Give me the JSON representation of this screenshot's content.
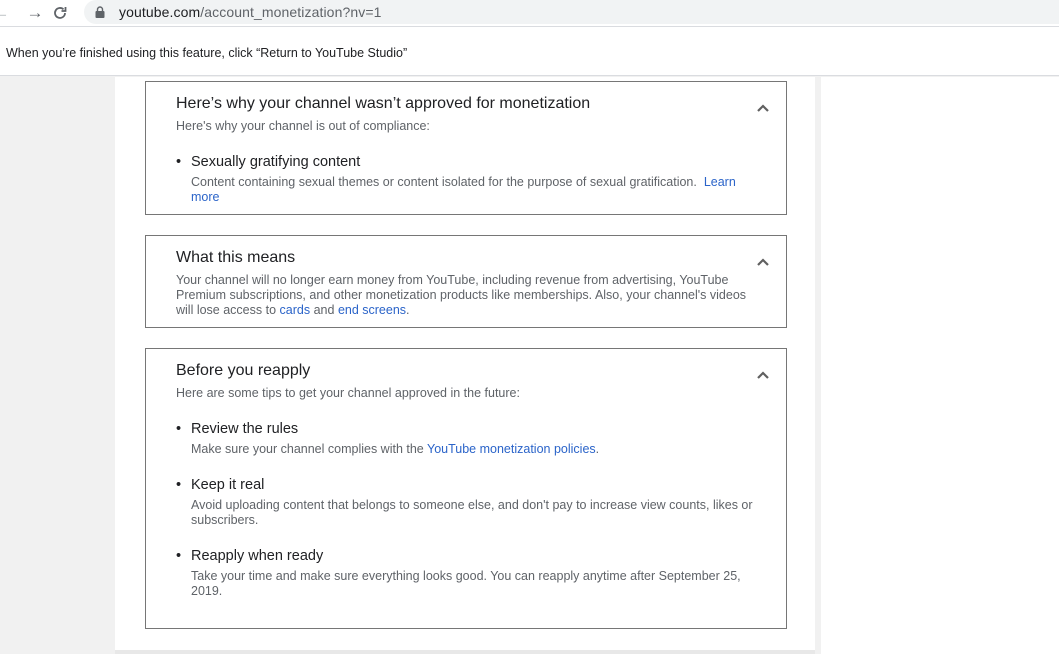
{
  "browser": {
    "url_host": "youtube.com",
    "url_path": "/account_monetization?nv=1"
  },
  "banner": {
    "text": "When you’re finished using this feature, click “Return to YouTube Studio”"
  },
  "cards": [
    {
      "title": "Here’s why your channel wasn’t approved for monetization",
      "subtitle": "Here's why your channel is out of compliance:",
      "items": [
        {
          "title": "Sexually gratifying content",
          "desc": "Content containing sexual themes or content isolated for the purpose of sexual gratification.",
          "link": "Learn",
          "link2": "more"
        }
      ]
    },
    {
      "title": "What this means",
      "para_1": "Your channel will no longer earn money from YouTube, including revenue from advertising, YouTube",
      "para_2": "Premium subscriptions, and other monetization products like memberships. Also, your channel's videos",
      "para_3_pre": "will lose access to",
      "link_cards": "cards",
      "para_3_mid": "and",
      "link_end_screens": "end screens",
      "para_3_post": "."
    },
    {
      "title": "Before you reapply",
      "subtitle": "Here are some tips to get your channel approved in the future:",
      "items": [
        {
          "title": "Review the rules",
          "desc": "Make sure your channel complies with the",
          "link": "YouTube monetization policies",
          "desc_post": "."
        },
        {
          "title": "Keep it real",
          "desc": "Avoid uploading content that belongs to someone else, and don't pay to increase view counts, likes or",
          "desc2": "subscribers."
        },
        {
          "title": "Reapply when ready",
          "desc": "Take your time and make sure everything looks good. You can reapply anytime after September 25,",
          "desc2": "2019."
        }
      ]
    }
  ],
  "colors": {
    "link": "#2b64c9",
    "card_border": "#767676",
    "muted_text": "#5f6368"
  },
  "icons": [
    "back-arrow-icon",
    "forward-arrow-icon",
    "reload-icon",
    "lock-icon",
    "chevron-up-icon"
  ]
}
